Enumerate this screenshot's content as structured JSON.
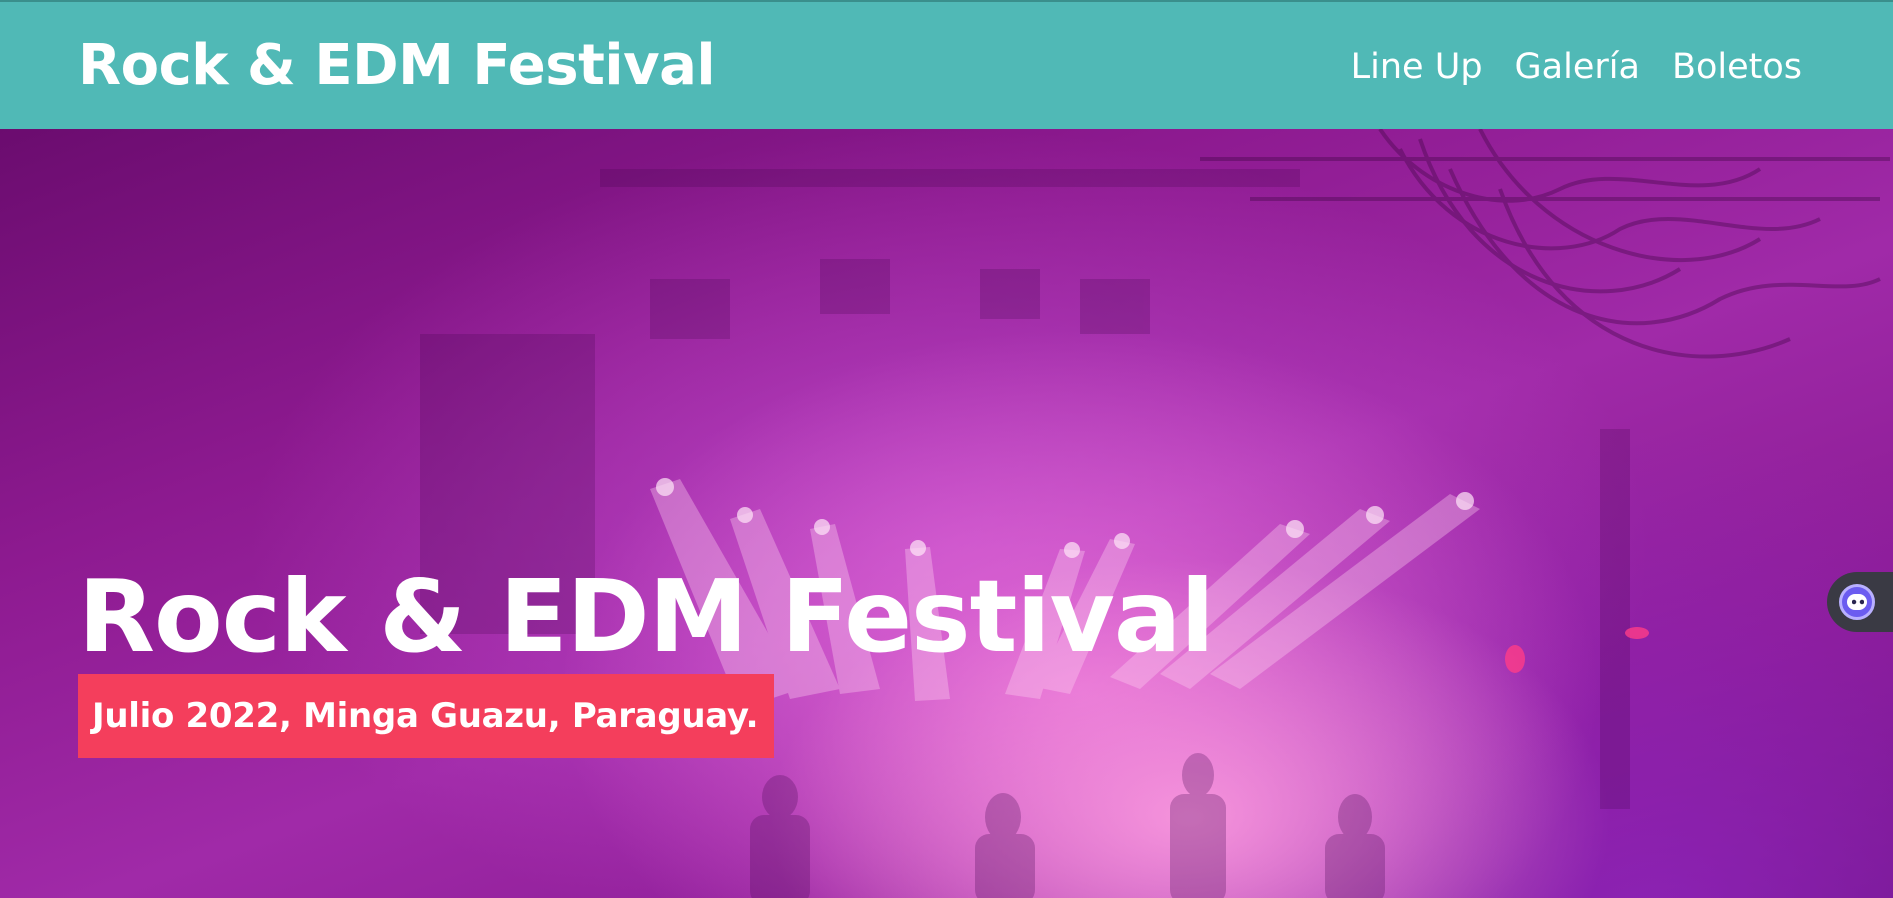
{
  "header": {
    "brand": "Rock & EDM Festival",
    "nav": [
      {
        "label": "Line Up"
      },
      {
        "label": "Galería"
      },
      {
        "label": "Boletos"
      }
    ]
  },
  "hero": {
    "title": "Rock & EDM Festival",
    "tagline": "Julio 2022, Minga Guazu, Paraguay."
  },
  "colors": {
    "header_bg": "#50b9b6",
    "tag_bg": "#f43e5c",
    "text": "#ffffff"
  },
  "widgets": {
    "assistant_icon": "assistant-bot-icon"
  }
}
